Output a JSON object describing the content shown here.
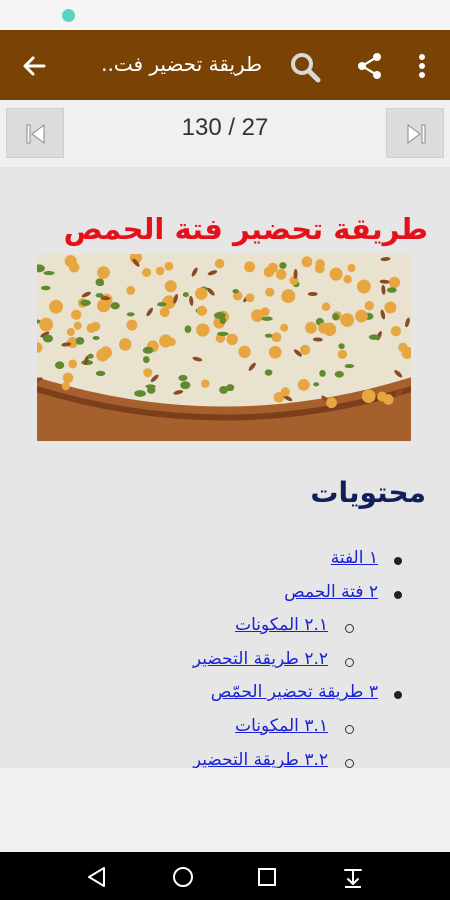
{
  "app_bar": {
    "title": "طريقة تحضير فت..",
    "icons": [
      "back-arrow-icon",
      "search-icon",
      "share-icon",
      "more-vert-icon"
    ],
    "color": "#7a4305"
  },
  "pager": {
    "counter": "130 / 27",
    "icons": [
      "first-page-icon",
      "last-page-icon"
    ]
  },
  "article": {
    "title": "طريقة تحضير فتة الحمص",
    "title_color": "#e6101a",
    "toc_heading": "محتويات",
    "toc": [
      {
        "label": "١ الفتة",
        "level": 1
      },
      {
        "label": "٢ فتة الحمص",
        "level": 1
      },
      {
        "label": "٢.١ المكونات",
        "level": 2
      },
      {
        "label": "٢.٢ طريقة التحضير",
        "level": 2
      },
      {
        "label": "٣ طريقة تحضير الحمّص",
        "level": 1
      },
      {
        "label": "٣.١ المكونات",
        "level": 2
      },
      {
        "label": "٣.٢ طريقة التحضير",
        "level": 2
      }
    ],
    "link_color": "#1a22d8"
  },
  "nav_bar": {
    "icons": [
      "back-triangle-icon",
      "home-circle-icon",
      "recents-square-icon",
      "download-icon"
    ]
  }
}
